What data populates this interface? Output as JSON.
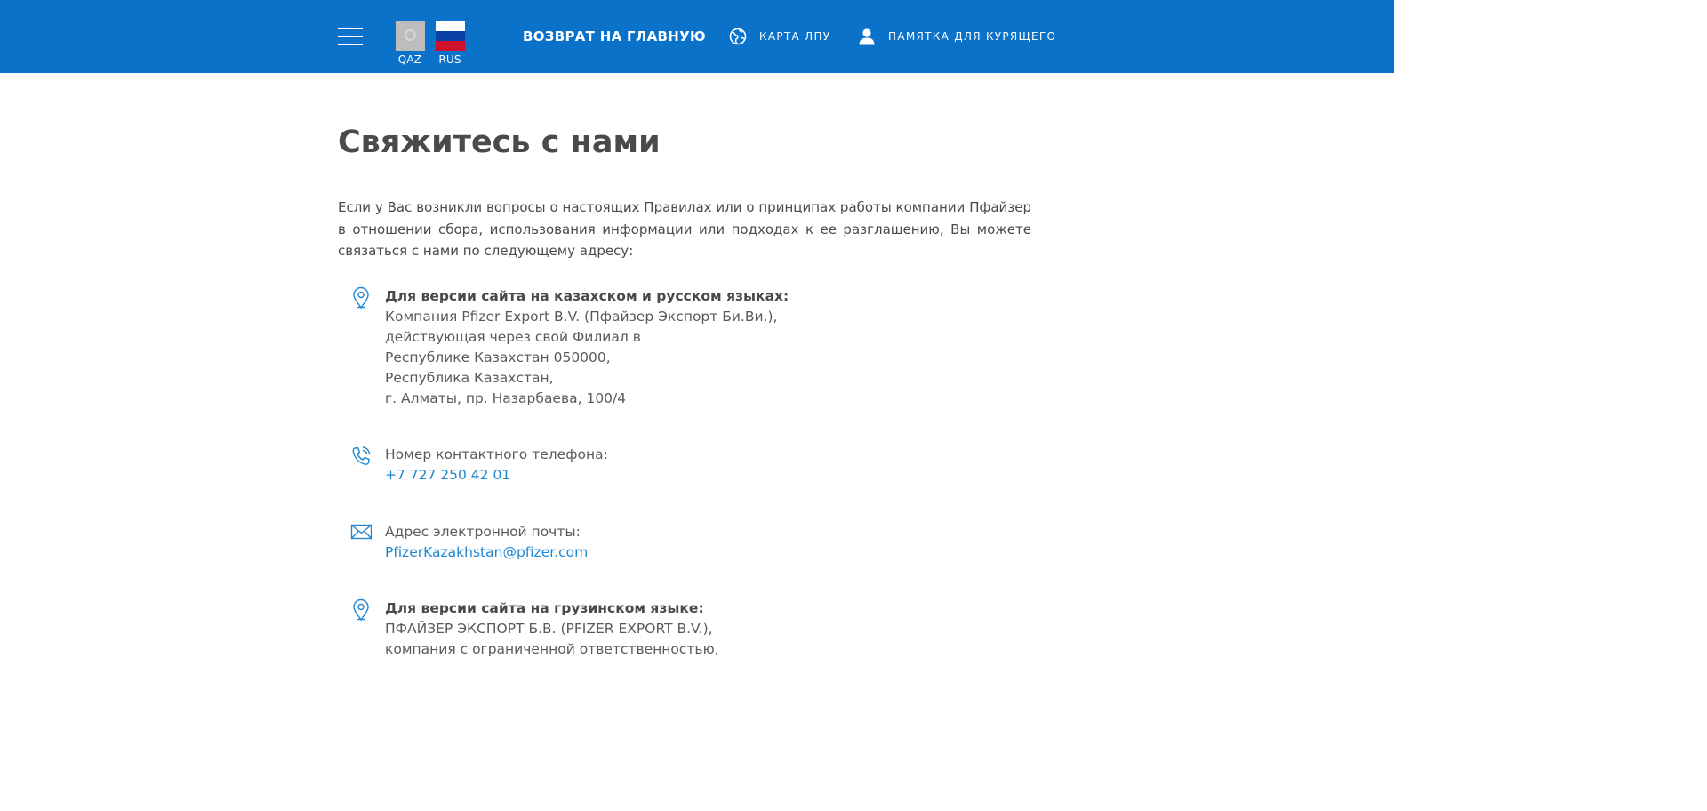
{
  "header": {
    "languages": [
      {
        "code": "QAZ",
        "flag_icon": "kazakhstan-flag-icon"
      },
      {
        "code": "RUS",
        "flag_icon": "russia-flag-icon"
      }
    ],
    "home_label": "ВОЗВРАТ НА ГЛАВНУЮ",
    "map_label": "КАРТА ЛПУ",
    "memo_label": "ПАМЯТКА ДЛЯ КУРЯЩЕГО",
    "colors": {
      "bar": "#0a72c9",
      "text": "#ffffff"
    }
  },
  "main": {
    "title": "Свяжитесь с нами",
    "intro": "Если у Вас возникли вопросы о настоящих Правилах или о принципах работы компании Пфайзер в отношении сбора, использования информации или подходах к ее разглашению, Вы можете связаться с нами по следующему адресу:",
    "address_kz": {
      "heading": "Для версии сайта на казахском и русском языках:",
      "lines": [
        "Компания Pfizer Export B.V. (Пфайзер Экспорт Би.Ви.),",
        "действующая через свой Филиал в",
        "Республике Казахстан 050000,",
        "Республика Казахстан,",
        "г. Алматы, пр. Назарбаева, 100/4"
      ]
    },
    "phone": {
      "label": "Номер контактного телефона:",
      "value": "+7 727 250 42 01"
    },
    "email": {
      "label": "Адрес электронной почты:",
      "value": "PfizerKazakhstan@pfizer.com"
    },
    "address_ge": {
      "heading": "Для версии сайта на грузинском языке:",
      "lines": [
        "ПФАЙЗЕР ЭКСПОРТ Б.В. (PFIZER EXPORT B.V.),",
        "компания с ограниченной ответственностью,"
      ]
    },
    "colors": {
      "link": "#1f86d1",
      "icon": "#1f86d1",
      "text": "#4a4a4a"
    }
  }
}
